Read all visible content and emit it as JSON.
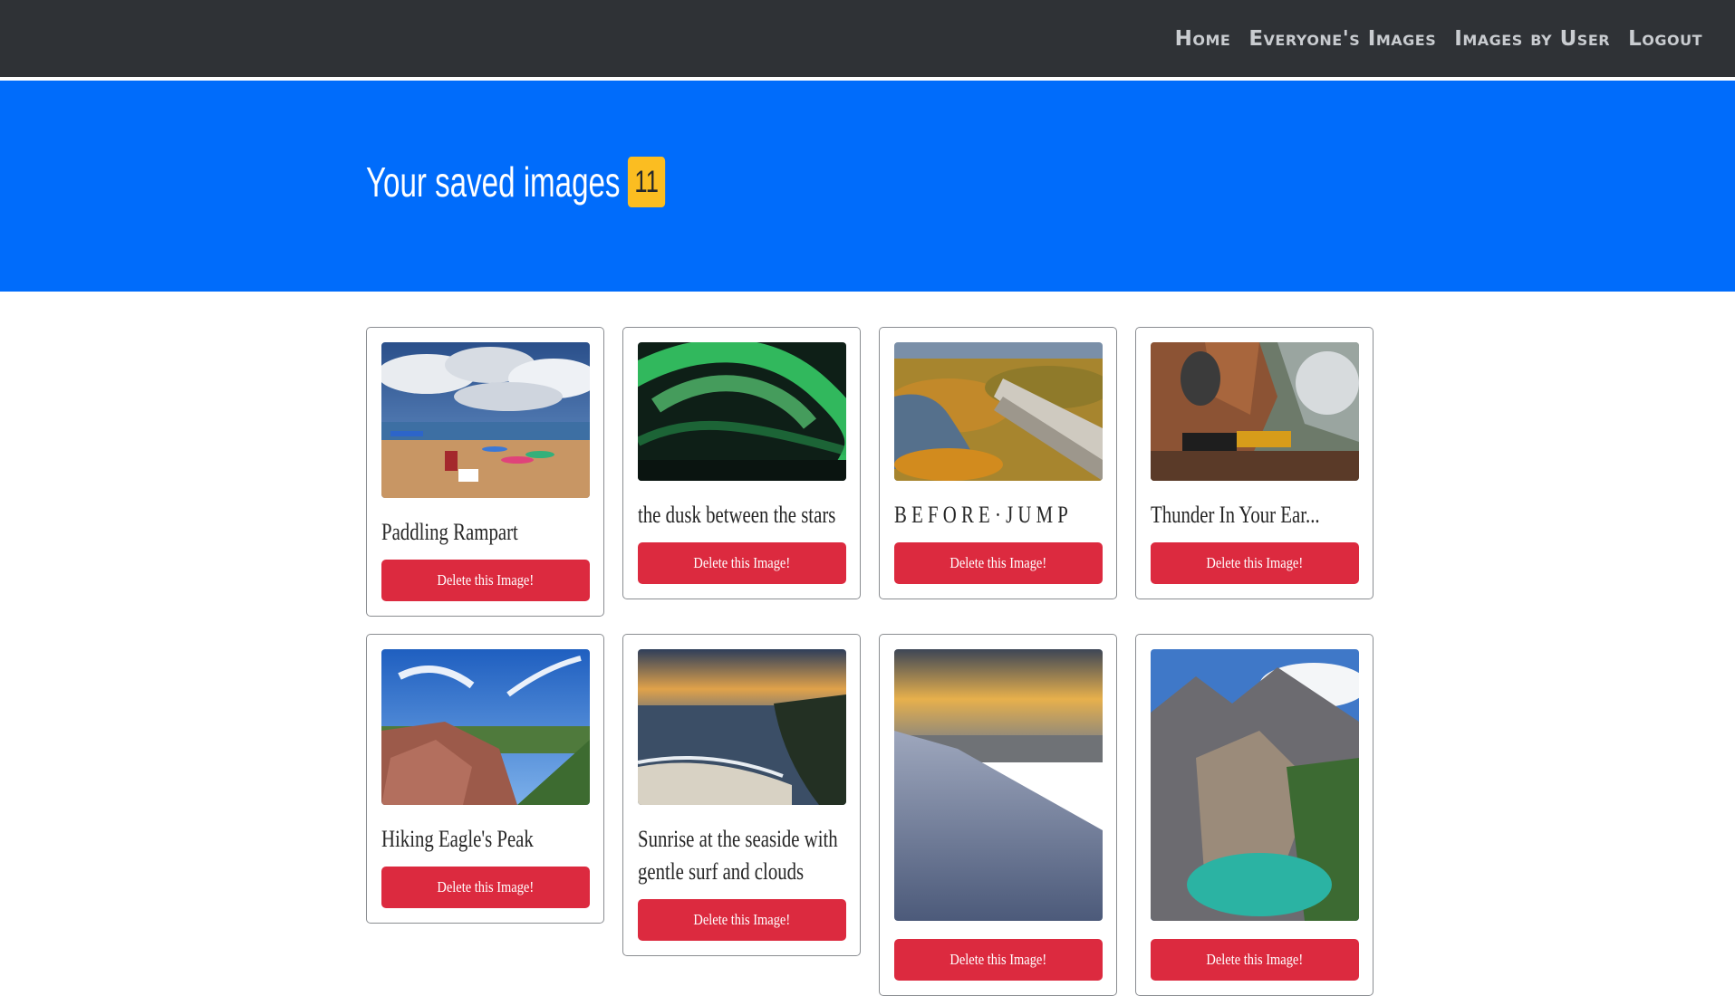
{
  "nav": {
    "links": [
      "Home",
      "Everyone's Images",
      "Images by User",
      "Logout"
    ]
  },
  "hero": {
    "title": "Your saved images",
    "count": "11"
  },
  "cards": [
    {
      "title": "Paddling Rampart",
      "button": "Delete this Image!",
      "image": "lake-beach-kayaks-clouds"
    },
    {
      "title": "the dusk between the stars",
      "button": "Delete this Image!",
      "image": "green-aurora"
    },
    {
      "title": "B E F O R E · J U M P",
      "button": "Delete this Image!",
      "image": "dam-autumn-forest"
    },
    {
      "title": "Thunder In Your Ear...",
      "button": "Delete this Image!",
      "image": "steam-train-canyon"
    },
    {
      "title": "Hiking Eagle's Peak",
      "button": "Delete this Image!",
      "image": "rocky-summit-view"
    },
    {
      "title": "Sunrise at the seaside with gentle surf and clouds",
      "button": "Delete this Image!",
      "image": "seaside-sunrise"
    },
    {
      "title": "",
      "button": "Delete this Image!",
      "image": "snowy-shore-sunset"
    },
    {
      "title": "",
      "button": "Delete this Image!",
      "image": "alpine-lake-mountains"
    }
  ],
  "colors": {
    "navbar": "#2f3236",
    "hero": "#006cfb",
    "badge": "#fbbd21",
    "danger": "#dc2a3f"
  }
}
